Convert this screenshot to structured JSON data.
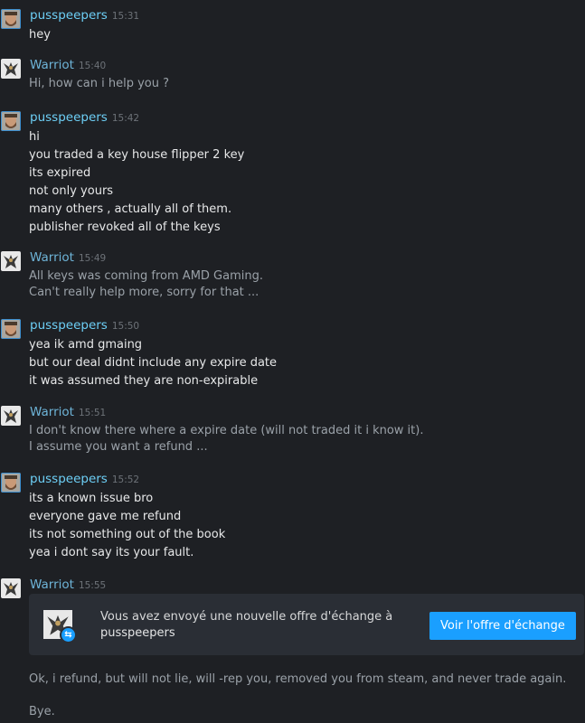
{
  "messages": [
    {
      "sender": "pusspeepers",
      "time": "15:31",
      "lines": [
        "hey"
      ]
    },
    {
      "sender": "Warriot",
      "time": "15:40",
      "lines": [
        "Hi, how can i help you ?"
      ]
    },
    {
      "sender": "pusspeepers",
      "time": "15:42",
      "lines": [
        "hi",
        "you traded a key house flipper 2 key",
        "its expired",
        "not only yours",
        "many others , actually all of them.",
        "publisher revoked all of the keys"
      ]
    },
    {
      "sender": "Warriot",
      "time": "15:49",
      "lines": [
        "All keys was coming from AMD Gaming.",
        "Can't really help more, sorry for that ..."
      ]
    },
    {
      "sender": "pusspeepers",
      "time": "15:50",
      "lines": [
        "yea ik amd gmaing",
        "but our deal didnt include any expire date",
        "it was assumed they are non-expirable"
      ]
    },
    {
      "sender": "Warriot",
      "time": "15:51",
      "lines": [
        "I don't know there where a expire date (will not traded it i know it).",
        "I assume you want a refund ..."
      ]
    },
    {
      "sender": "pusspeepers",
      "time": "15:52",
      "lines": [
        "its a known issue bro",
        "everyone gave me refund",
        "its not something out of the book",
        "yea i dont say its your fault."
      ]
    },
    {
      "sender": "Warriot",
      "time": "15:55",
      "lines": []
    }
  ],
  "trade_offer": {
    "text": "Vous avez envoyé une nouvelle offre d'échange à",
    "recipient": "pusspeepers",
    "button_label": "Voir l'offre d'échange"
  },
  "after_trade": [
    "Ok, i refund, but will not lie, will -rep you, removed you from steam, and never trade again.",
    "Bye."
  ],
  "colors": {
    "background": "#1e2024",
    "friend_name": "#6dcff6",
    "self_name": "#6eb4d8",
    "accent_button": "#1a9fff",
    "card_bg": "#2a2e35"
  },
  "icons": {
    "friend_avatar": "bearded-man-avatar",
    "self_avatar": "warrior-figure-avatar",
    "trade_badge": "trade-arrows-icon"
  }
}
